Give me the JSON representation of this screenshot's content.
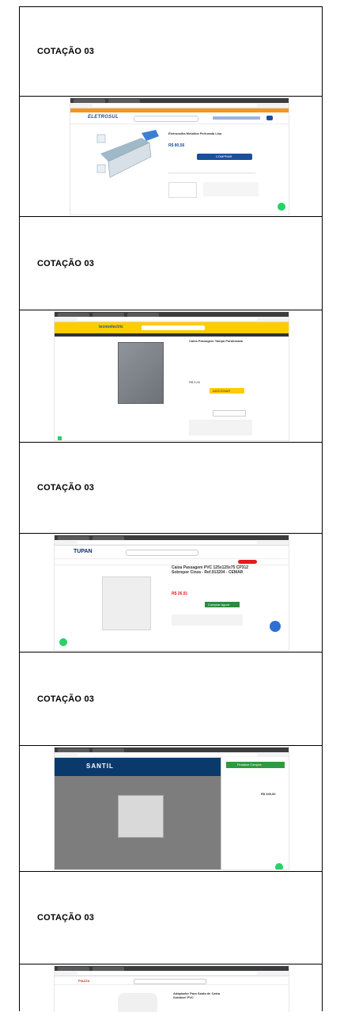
{
  "section_label": "COTAÇÃO 03",
  "screenshots": [
    {
      "store_logo": "ELETROSUL",
      "product_title": "Eletrocalha Metálica Perfurada Lisa",
      "price": "R$ 80,56",
      "buy_button": "COMPRAR"
    },
    {
      "store_logo": "tecnoelectric",
      "product_title": "Caixa Passagem Tampa Parafusada",
      "price": "R$ 5,40",
      "buy_button": "ADICIONAR"
    },
    {
      "store_logo": "TUPAN",
      "product_title": "Caixa Passagem PVC 125x125x75 CP312 Sobrepor Cinza - Ref.913204 - CEMAR",
      "price": "R$ 26,91",
      "buy_button": "Comprar Agora"
    },
    {
      "store_logo": "SANTIL",
      "cart_button": "Finalizar Compra",
      "price": "R$ 349,00"
    },
    {
      "store_logo": "PIAZZA",
      "product_title": "Adaptador Para Saída de Caixa Soldável PVC"
    }
  ]
}
